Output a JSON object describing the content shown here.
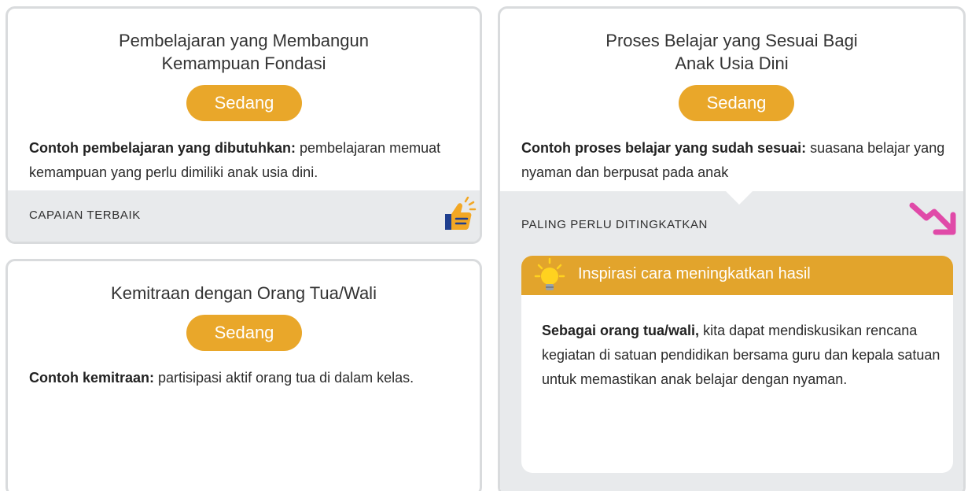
{
  "cards": {
    "foundation": {
      "title_line1": "Pembelajaran yang Membangun",
      "title_line2": "Kemampuan Fondasi",
      "badge": "Sedang",
      "example_label": "Contoh pembelajaran yang dibutuhkan:",
      "example_text": " pembelajaran memuat kemampuan yang perlu dimiliki anak usia dini.",
      "footer_label": "CAPAIAN TERBAIK",
      "footer_icon": "thumbs-up-icon"
    },
    "partnership": {
      "title": "Kemitraan dengan Orang Tua/Wali",
      "badge": "Sedang",
      "example_label": "Contoh kemitraan:",
      "example_text": " partisipasi aktif orang tua di dalam kelas."
    },
    "learning_process": {
      "title_line1": "Proses Belajar yang Sesuai Bagi",
      "title_line2": "Anak Usia Dini",
      "badge": "Sedang",
      "example_label": "Contoh proses belajar yang sudah sesuai:",
      "example_text": " suasana belajar yang nyaman dan berpusat pada anak",
      "footer_label": "PALING PERLU DITINGKATKAN",
      "footer_icon": "trend-down-icon",
      "inspiration": {
        "title": "Inspirasi cara meningkatkan hasil",
        "icon": "lightbulb-icon",
        "text_bold": "Sebagai orang tua/wali,",
        "text": " kita dapat mendiskusikan rencana kegiatan di satuan pendidikan bersama guru dan kepala satuan untuk memastikan anak belajar dengan nyaman."
      }
    }
  },
  "colors": {
    "badge": "#e9a72a",
    "inspiration_header": "#e2a42c",
    "footer_bg": "#e8eaec",
    "card_border": "#d9dbdd",
    "trend_icon": "#e04aa8",
    "thumb_icon": "#f2a724"
  }
}
